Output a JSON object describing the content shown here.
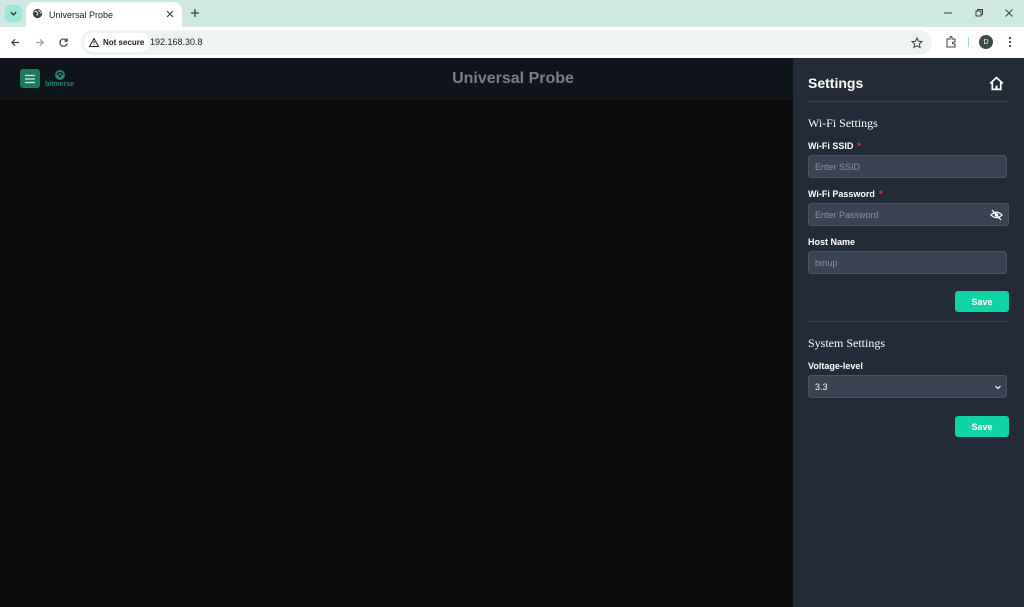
{
  "browser": {
    "tab_title": "Universal Probe",
    "security_label": "Not secure",
    "url": "192.168.30.8",
    "profile_initial": "D"
  },
  "app": {
    "title": "Universal Probe",
    "logo_text": "bitmerse"
  },
  "settings": {
    "title": "Settings",
    "wifi": {
      "section_title": "Wi-Fi Settings",
      "ssid_label": "Wi-Fi SSID",
      "ssid_placeholder": "Enter SSID",
      "password_label": "Wi-Fi Password",
      "password_placeholder": "Enter Password",
      "host_label": "Host Name",
      "host_placeholder": "bmup",
      "required_mark": "*",
      "save_label": "Save"
    },
    "system": {
      "section_title": "System Settings",
      "voltage_label": "Voltage-level",
      "voltage_value": "3.3",
      "save_label": "Save"
    }
  },
  "colors": {
    "accent": "#10d4a5",
    "panel_bg": "#222b37",
    "page_bg": "#0d0d0d",
    "required": "#e53935"
  },
  "icons": [
    "tab-search-icon",
    "globe-icon",
    "close-icon",
    "plus-icon",
    "minimize-icon",
    "restore-icon",
    "window-close-icon",
    "back-icon",
    "forward-icon",
    "reload-icon",
    "warning-icon",
    "star-icon",
    "extensions-icon",
    "kebab-icon",
    "hamburger-icon",
    "logo-icon",
    "home-icon",
    "eye-off-icon",
    "chevron-down-icon"
  ]
}
